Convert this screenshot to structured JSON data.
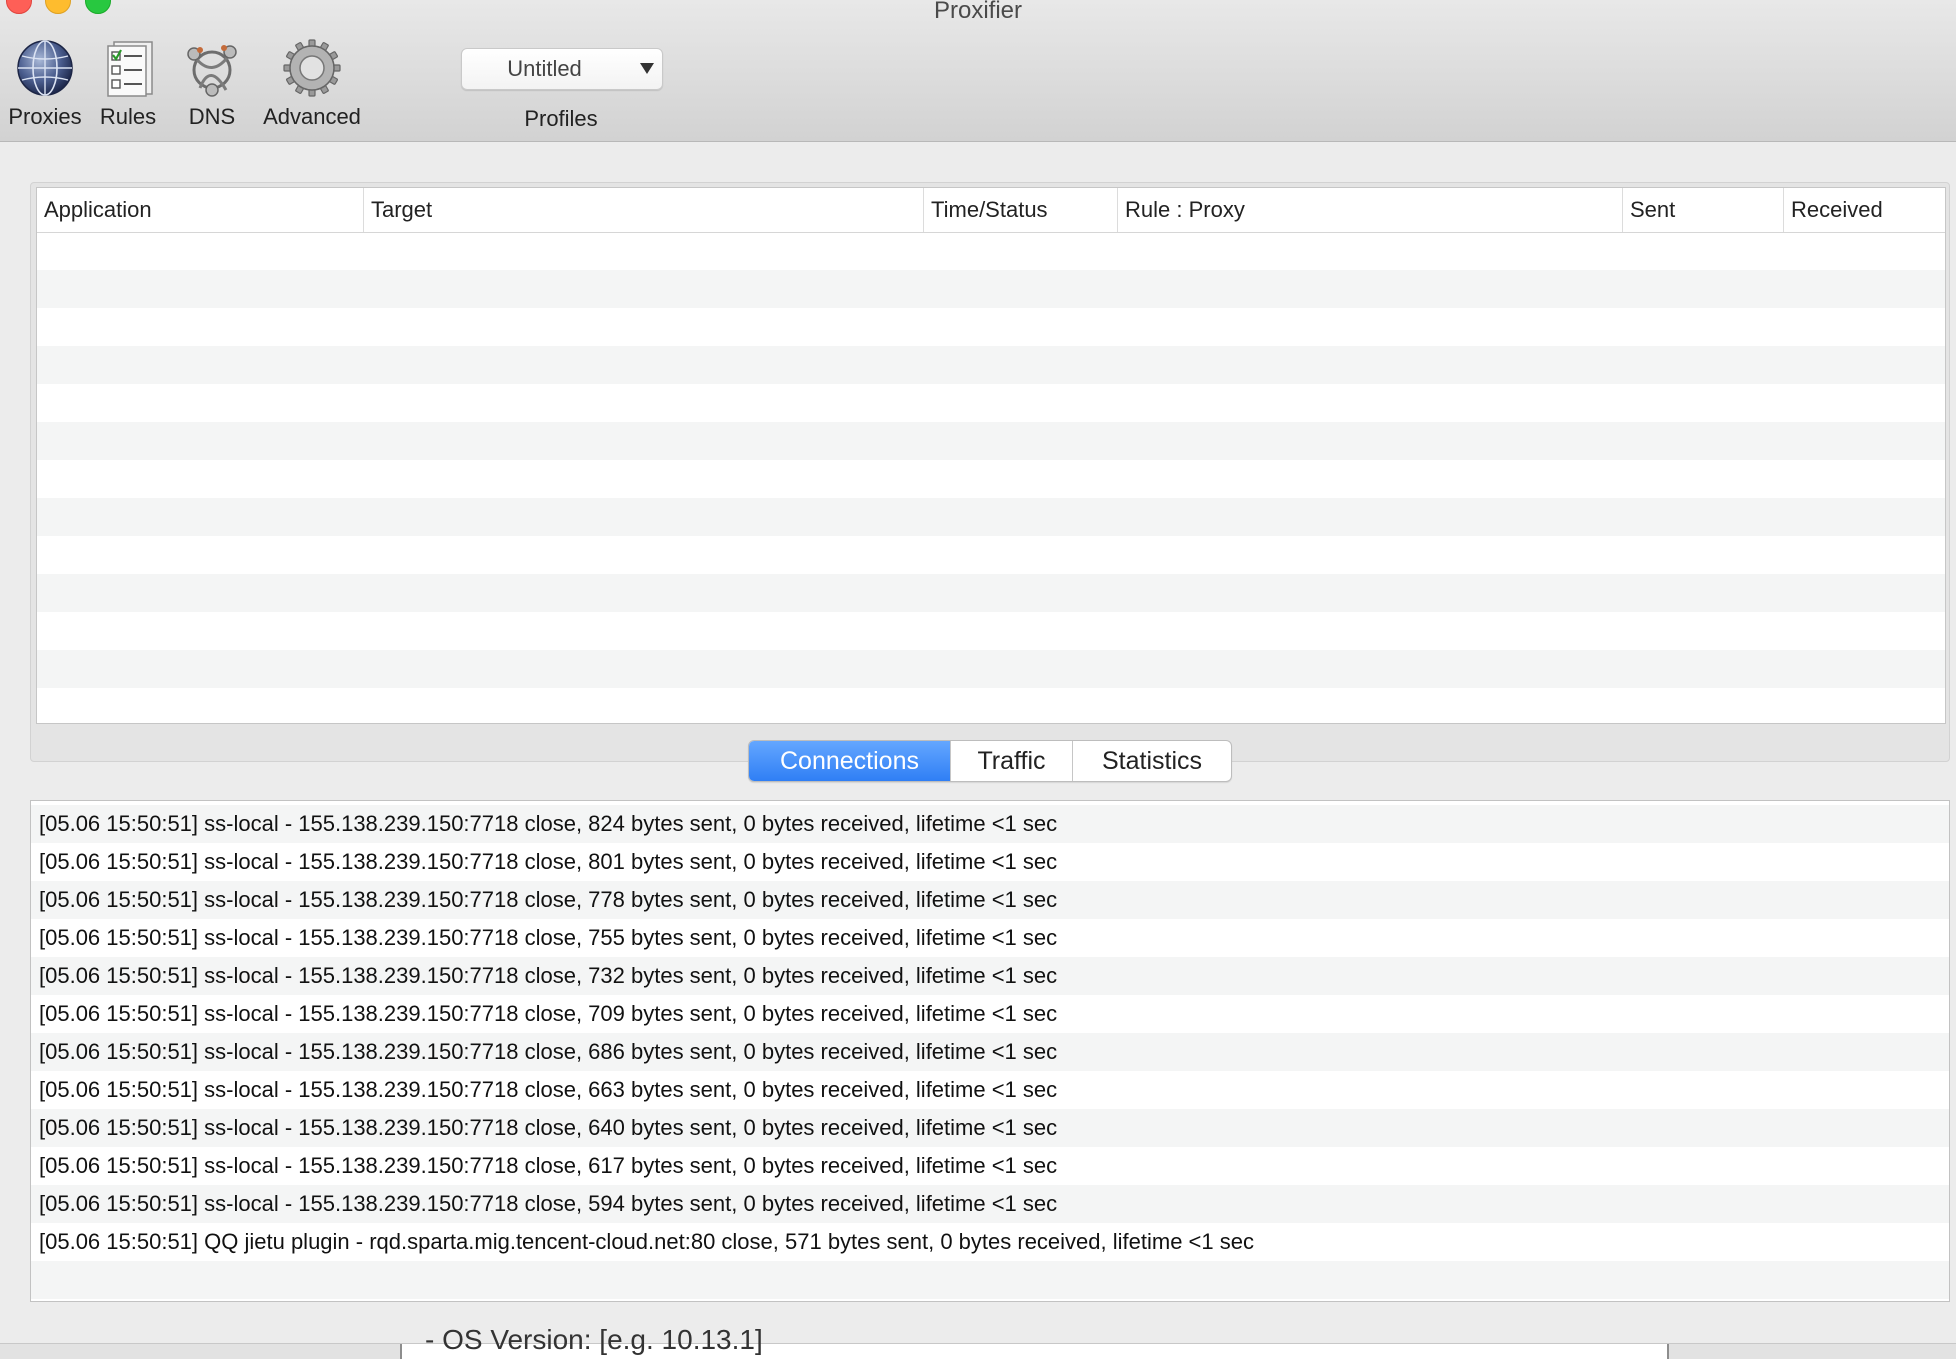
{
  "window": {
    "title": "Proxifier"
  },
  "toolbar": {
    "items": [
      {
        "label": "Proxies",
        "icon": "globe-icon"
      },
      {
        "label": "Rules",
        "icon": "checklist-icon"
      },
      {
        "label": "DNS",
        "icon": "network-icon"
      },
      {
        "label": "Advanced",
        "icon": "gear-icon"
      }
    ],
    "profile_value": "Untitled",
    "profiles_label": "Profiles"
  },
  "table": {
    "columns": [
      "Application",
      "Target",
      "Time/Status",
      "Rule : Proxy",
      "Sent",
      "Received"
    ],
    "rows": []
  },
  "tabs": [
    {
      "label": "Connections",
      "active": true
    },
    {
      "label": "Traffic",
      "active": false
    },
    {
      "label": "Statistics",
      "active": false
    }
  ],
  "log": [
    "[05.06 15:50:51] ss-local - 155.138.239.150:7718 close, 824 bytes sent, 0 bytes received, lifetime <1 sec",
    "[05.06 15:50:51] ss-local - 155.138.239.150:7718 close, 801 bytes sent, 0 bytes received, lifetime <1 sec",
    "[05.06 15:50:51] ss-local - 155.138.239.150:7718 close, 778 bytes sent, 0 bytes received, lifetime <1 sec",
    "[05.06 15:50:51] ss-local - 155.138.239.150:7718 close, 755 bytes sent, 0 bytes received, lifetime <1 sec",
    "[05.06 15:50:51] ss-local - 155.138.239.150:7718 close, 732 bytes sent, 0 bytes received, lifetime <1 sec",
    "[05.06 15:50:51] ss-local - 155.138.239.150:7718 close, 709 bytes sent, 0 bytes received, lifetime <1 sec",
    "[05.06 15:50:51] ss-local - 155.138.239.150:7718 close, 686 bytes sent, 0 bytes received, lifetime <1 sec",
    "[05.06 15:50:51] ss-local - 155.138.239.150:7718 close, 663 bytes sent, 0 bytes received, lifetime <1 sec",
    "[05.06 15:50:51] ss-local - 155.138.239.150:7718 close, 640 bytes sent, 0 bytes received, lifetime <1 sec",
    "[05.06 15:50:51] ss-local - 155.138.239.150:7718 close, 617 bytes sent, 0 bytes received, lifetime <1 sec",
    "[05.06 15:50:51] ss-local - 155.138.239.150:7718 close, 594 bytes sent, 0 bytes received, lifetime <1 sec",
    "[05.06 15:50:51] QQ jietu plugin - rqd.sparta.mig.tencent-cloud.net:80 close, 571 bytes sent, 0 bytes received, lifetime <1 sec"
  ],
  "background_window": {
    "text": "- OS Version: [e.g. 10.13.1]"
  },
  "colors": {
    "accent": "#2f7ff5",
    "row_stripe": "#f4f5f5"
  }
}
